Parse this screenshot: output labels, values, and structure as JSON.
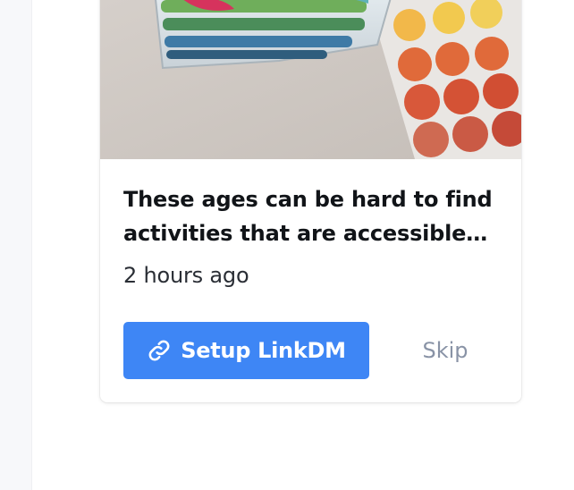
{
  "card": {
    "image_alt": "Markers in a clear case next to sheets of colored dot stickers",
    "caption": "These ages can be hard to find activities that are accessible an…",
    "timestamp": "2 hours ago",
    "primary_action": {
      "label": "Setup LinkDM",
      "icon": "link-icon",
      "color": "#3e86f5"
    },
    "secondary_action": {
      "label": "Skip",
      "color": "#8993a6"
    }
  }
}
